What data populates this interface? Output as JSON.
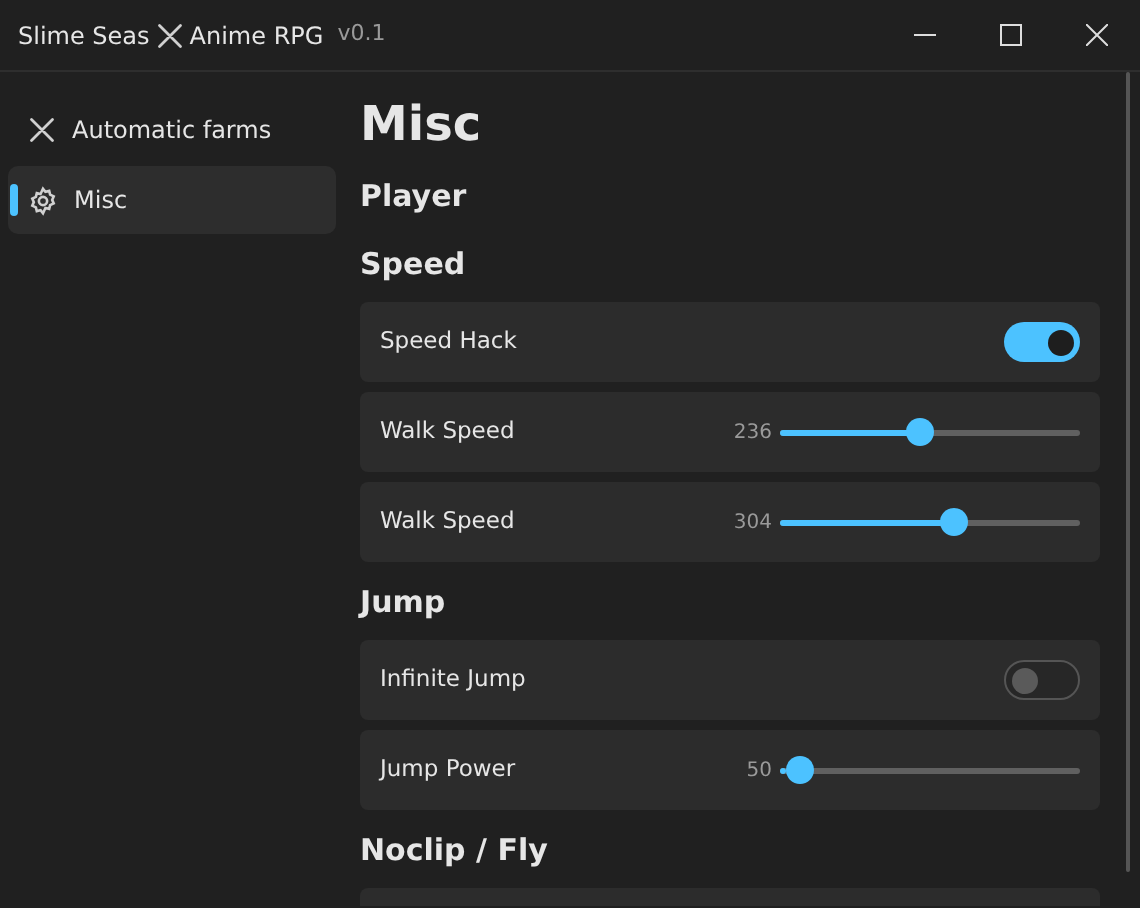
{
  "window": {
    "title_left": "Slime Seas",
    "title_right": "Anime RPG",
    "version": "v0.1"
  },
  "sidebar": {
    "items": [
      {
        "label": "Automatic farms",
        "selected": false
      },
      {
        "label": "Misc",
        "selected": true
      }
    ]
  },
  "page": {
    "title": "Misc",
    "items": [
      {
        "kind": "heading",
        "label": "Player"
      },
      {
        "kind": "heading",
        "label": "Speed"
      },
      {
        "kind": "toggle",
        "label": "Speed Hack",
        "on": true
      },
      {
        "kind": "slider",
        "label": "Walk Speed",
        "reading": "236",
        "level": 0.46
      },
      {
        "kind": "slider",
        "label": "Walk Speed",
        "reading": "304",
        "level": 0.59
      },
      {
        "kind": "heading",
        "label": "Jump"
      },
      {
        "kind": "toggle",
        "label": "Infinite Jump",
        "on": false
      },
      {
        "kind": "slider",
        "label": "Jump Power",
        "reading": "50",
        "level": 0.02
      },
      {
        "kind": "heading",
        "label": "Noclip / Fly"
      },
      {
        "kind": "card"
      }
    ]
  }
}
